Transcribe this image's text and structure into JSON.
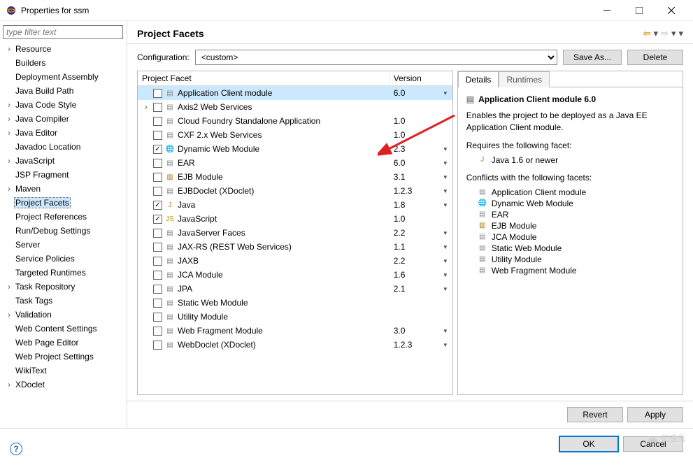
{
  "window": {
    "title": "Properties for ssm"
  },
  "sidebar": {
    "filter_placeholder": "type filter text",
    "items": [
      {
        "label": "Resource",
        "expandable": true
      },
      {
        "label": "Builders",
        "expandable": false
      },
      {
        "label": "Deployment Assembly",
        "expandable": false
      },
      {
        "label": "Java Build Path",
        "expandable": false
      },
      {
        "label": "Java Code Style",
        "expandable": true
      },
      {
        "label": "Java Compiler",
        "expandable": true
      },
      {
        "label": "Java Editor",
        "expandable": true
      },
      {
        "label": "Javadoc Location",
        "expandable": false
      },
      {
        "label": "JavaScript",
        "expandable": true
      },
      {
        "label": "JSP Fragment",
        "expandable": false
      },
      {
        "label": "Maven",
        "expandable": true
      },
      {
        "label": "Project Facets",
        "expandable": false,
        "selected": true
      },
      {
        "label": "Project References",
        "expandable": false
      },
      {
        "label": "Run/Debug Settings",
        "expandable": false
      },
      {
        "label": "Server",
        "expandable": false
      },
      {
        "label": "Service Policies",
        "expandable": false
      },
      {
        "label": "Targeted Runtimes",
        "expandable": false
      },
      {
        "label": "Task Repository",
        "expandable": true
      },
      {
        "label": "Task Tags",
        "expandable": false
      },
      {
        "label": "Validation",
        "expandable": true
      },
      {
        "label": "Web Content Settings",
        "expandable": false
      },
      {
        "label": "Web Page Editor",
        "expandable": false
      },
      {
        "label": "Web Project Settings",
        "expandable": false
      },
      {
        "label": "WikiText",
        "expandable": false
      },
      {
        "label": "XDoclet",
        "expandable": true
      }
    ]
  },
  "page": {
    "title": "Project Facets",
    "config_label": "Configuration:",
    "config_value": "<custom>",
    "save_as": "Save As...",
    "delete": "Delete",
    "revert": "Revert",
    "apply": "Apply",
    "ok": "OK",
    "cancel": "Cancel"
  },
  "facets": {
    "col1": "Project Facet",
    "col2": "Version",
    "rows": [
      {
        "name": "Application Client module",
        "version": "6.0",
        "checked": false,
        "dd": true,
        "icon": "page",
        "sel": true
      },
      {
        "name": "Axis2 Web Services",
        "version": "",
        "checked": false,
        "dd": false,
        "icon": "page",
        "tw": true
      },
      {
        "name": "Cloud Foundry Standalone Application",
        "version": "1.0",
        "checked": false,
        "dd": false,
        "icon": "page"
      },
      {
        "name": "CXF 2.x Web Services",
        "version": "1.0",
        "checked": false,
        "dd": false,
        "icon": "page"
      },
      {
        "name": "Dynamic Web Module",
        "version": "2.3",
        "checked": true,
        "dd": true,
        "icon": "web"
      },
      {
        "name": "EAR",
        "version": "6.0",
        "checked": false,
        "dd": true,
        "icon": "page"
      },
      {
        "name": "EJB Module",
        "version": "3.1",
        "checked": false,
        "dd": true,
        "icon": "ear"
      },
      {
        "name": "EJBDoclet (XDoclet)",
        "version": "1.2.3",
        "checked": false,
        "dd": true,
        "icon": "page"
      },
      {
        "name": "Java",
        "version": "1.8",
        "checked": true,
        "dd": true,
        "icon": "java"
      },
      {
        "name": "JavaScript",
        "version": "1.0",
        "checked": true,
        "dd": false,
        "icon": "js"
      },
      {
        "name": "JavaServer Faces",
        "version": "2.2",
        "checked": false,
        "dd": true,
        "icon": "page"
      },
      {
        "name": "JAX-RS (REST Web Services)",
        "version": "1.1",
        "checked": false,
        "dd": true,
        "icon": "page"
      },
      {
        "name": "JAXB",
        "version": "2.2",
        "checked": false,
        "dd": true,
        "icon": "page"
      },
      {
        "name": "JCA Module",
        "version": "1.6",
        "checked": false,
        "dd": true,
        "icon": "page"
      },
      {
        "name": "JPA",
        "version": "2.1",
        "checked": false,
        "dd": true,
        "icon": "page"
      },
      {
        "name": "Static Web Module",
        "version": "",
        "checked": false,
        "dd": false,
        "icon": "page"
      },
      {
        "name": "Utility Module",
        "version": "",
        "checked": false,
        "dd": false,
        "icon": "page"
      },
      {
        "name": "Web Fragment Module",
        "version": "3.0",
        "checked": false,
        "dd": true,
        "icon": "page"
      },
      {
        "name": "WebDoclet (XDoclet)",
        "version": "1.2.3",
        "checked": false,
        "dd": true,
        "icon": "page"
      }
    ]
  },
  "details": {
    "tab_details": "Details",
    "tab_runtimes": "Runtimes",
    "heading": "Application Client module 6.0",
    "description": "Enables the project to be deployed as a Java EE Application Client module.",
    "requires_title": "Requires the following facet:",
    "requires": [
      {
        "icon": "java",
        "label": "Java 1.6 or newer"
      }
    ],
    "conflicts_title": "Conflicts with the following facets:",
    "conflicts": [
      {
        "icon": "page",
        "label": "Application Client module"
      },
      {
        "icon": "web",
        "label": "Dynamic Web Module"
      },
      {
        "icon": "page",
        "label": "EAR"
      },
      {
        "icon": "ear",
        "label": "EJB Module"
      },
      {
        "icon": "page",
        "label": "JCA Module"
      },
      {
        "icon": "page",
        "label": "Static Web Module"
      },
      {
        "icon": "page",
        "label": "Utility Module"
      },
      {
        "icon": "page",
        "label": "Web Fragment Module"
      }
    ]
  },
  "watermark": "亿速云"
}
